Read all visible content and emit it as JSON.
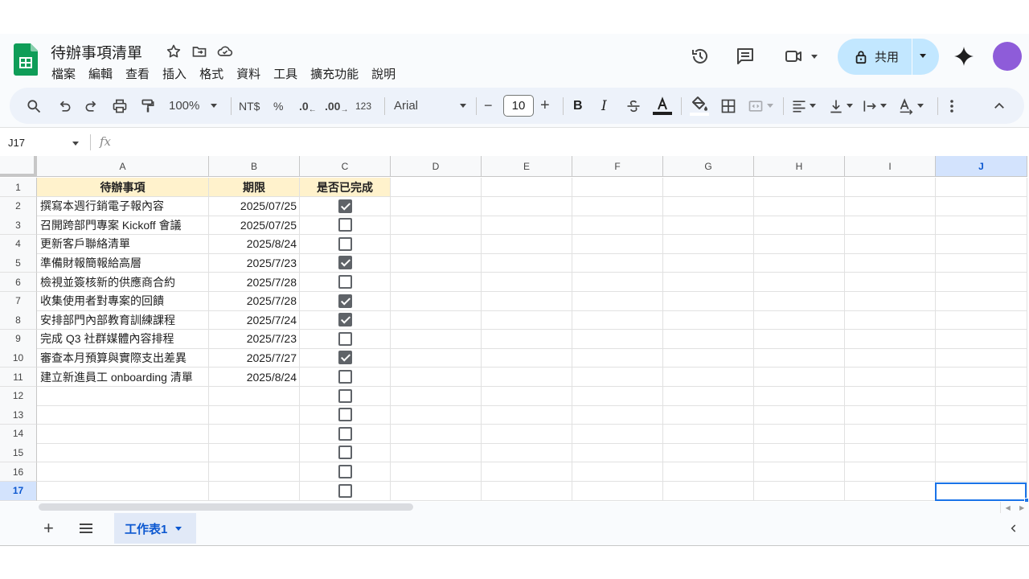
{
  "app": {
    "title": "待辦事項清單",
    "menu": [
      "檔案",
      "編輯",
      "查看",
      "插入",
      "格式",
      "資料",
      "工具",
      "擴充功能",
      "說明"
    ],
    "share_label": "共用",
    "colors": {
      "accent": "#0b57d0",
      "share_bg": "#c2e7ff",
      "header_fill": "#fff2cc",
      "avatar": "#8e5cd9",
      "sheets_green": "#0f9d58"
    }
  },
  "toolbar": {
    "zoom": "100%",
    "currency": "NT$",
    "percent": "%",
    "dec_decrease": ".0",
    "dec_increase": ".00",
    "number_format": "123",
    "font": "Arial",
    "font_size": "10",
    "minus": "−",
    "plus": "+",
    "bold": "B",
    "italic": "I"
  },
  "formula_bar": {
    "cell_ref": "J17",
    "fx": "fx",
    "value": ""
  },
  "grid": {
    "columns": [
      "A",
      "B",
      "C",
      "D",
      "E",
      "F",
      "G",
      "H",
      "I",
      "J"
    ],
    "rows": [
      "1",
      "2",
      "3",
      "4",
      "5",
      "6",
      "7",
      "8",
      "9",
      "10",
      "11",
      "12",
      "13",
      "14",
      "15",
      "16",
      "17"
    ],
    "selected_cell": "J17",
    "headers": [
      "待辦事項",
      "期限",
      "是否已完成"
    ],
    "tasks": [
      {
        "task": " 撰寫本週行銷電子報內容",
        "due": "2025/07/25",
        "done": true
      },
      {
        "task": "召開跨部門專案 Kickoff 會議",
        "due": "2025/07/25",
        "done": false
      },
      {
        "task": " 更新客戶聯絡清單",
        "due": "2025/8/24",
        "done": false
      },
      {
        "task": " 準備財報簡報給高層",
        "due": "2025/7/23",
        "done": true
      },
      {
        "task": "檢視並簽核新的供應商合約",
        "due": "2025/7/28",
        "done": false
      },
      {
        "task": "收集使用者對專案的回饋",
        "due": "2025/7/28",
        "done": true
      },
      {
        "task": "安排部門內部教育訓練課程",
        "due": "2025/7/24",
        "done": true
      },
      {
        "task": "完成 Q3 社群媒體內容排程",
        "due": "2025/7/23",
        "done": false
      },
      {
        "task": "審查本月預算與實際支出差異",
        "due": "2025/7/27",
        "done": true
      },
      {
        "task": " 建立新進員工 onboarding 清單",
        "due": "2025/8/24",
        "done": false
      },
      {
        "task": "",
        "due": "",
        "done": false
      },
      {
        "task": "",
        "due": "",
        "done": false
      },
      {
        "task": "",
        "due": "",
        "done": false
      },
      {
        "task": "",
        "due": "",
        "done": false
      },
      {
        "task": "",
        "due": "",
        "done": false
      },
      {
        "task": "",
        "due": "",
        "done": false
      }
    ]
  },
  "sheets": {
    "tabs": [
      "工作表1"
    ],
    "active": "工作表1"
  }
}
